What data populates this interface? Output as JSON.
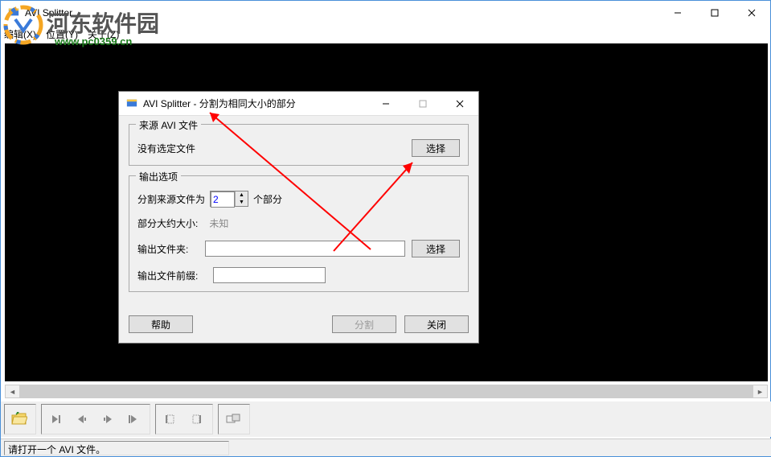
{
  "main": {
    "title": "AVI Splitter",
    "menu": {
      "edit": "编辑(X)",
      "view": "位置(Y)",
      "about": "关于(Z)"
    },
    "status": "请打开一个 AVI 文件。"
  },
  "watermark": {
    "text": "河东软件园",
    "url": "www.pc0359.cn"
  },
  "dialog": {
    "title": "AVI Splitter - 分割为相同大小的部分",
    "group_source": {
      "legend": "来源 AVI 文件",
      "no_file": "没有选定文件",
      "select_btn": "选择"
    },
    "group_output": {
      "legend": "输出选项",
      "split_label": "分割来源文件为",
      "split_value": "2",
      "parts_label": "个部分",
      "size_label": "部分大约大小:",
      "size_value": "未知",
      "folder_label": "输出文件夹:",
      "folder_value": "",
      "folder_btn": "选择",
      "prefix_label": "输出文件前缀:",
      "prefix_value": ""
    },
    "footer": {
      "help": "帮助",
      "split": "分割",
      "close": "关闭"
    }
  }
}
